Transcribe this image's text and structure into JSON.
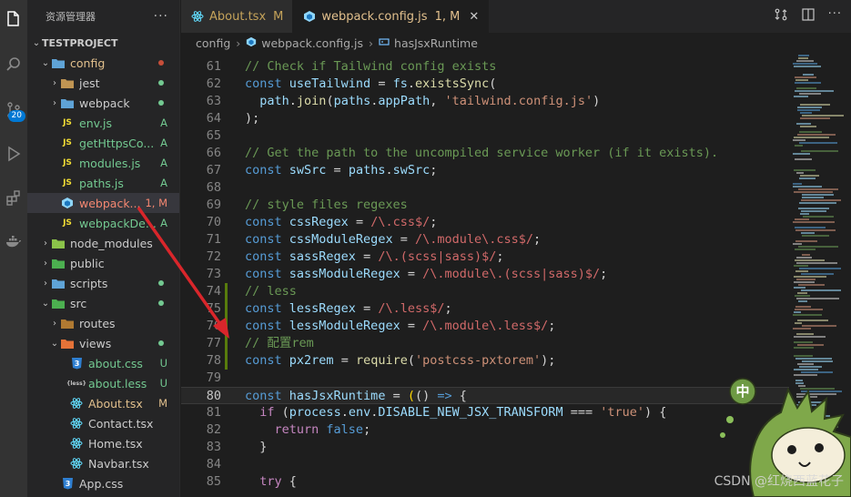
{
  "sidebar": {
    "title": "资源管理器",
    "more_label": "···",
    "tree": [
      {
        "label": "TESTPROJECT",
        "kind": "root",
        "chevron": "open",
        "indent": 0,
        "icon": "",
        "status": "",
        "status_color": ""
      },
      {
        "label": "config",
        "kind": "folder",
        "chevron": "open",
        "indent": 1,
        "icon": "folder-config-icon",
        "status": "dot",
        "status_color": "#c74e39"
      },
      {
        "label": "jest",
        "kind": "folder",
        "chevron": "closed",
        "indent": 2,
        "icon": "folder-icon",
        "status": "dot",
        "status_color": "#73c991"
      },
      {
        "label": "webpack",
        "kind": "folder",
        "chevron": "closed",
        "indent": 2,
        "icon": "folder-webpack-icon",
        "status": "dot",
        "status_color": "#73c991"
      },
      {
        "label": "env.js",
        "kind": "file",
        "chevron": "",
        "indent": 2,
        "icon": "js-icon",
        "status": "A",
        "status_color": "#73c991"
      },
      {
        "label": "getHttpsCo...",
        "kind": "file",
        "chevron": "",
        "indent": 2,
        "icon": "js-icon",
        "status": "A",
        "status_color": "#73c991"
      },
      {
        "label": "modules.js",
        "kind": "file",
        "chevron": "",
        "indent": 2,
        "icon": "js-icon",
        "status": "A",
        "status_color": "#73c991"
      },
      {
        "label": "paths.js",
        "kind": "file",
        "chevron": "",
        "indent": 2,
        "icon": "js-icon",
        "status": "A",
        "status_color": "#73c991"
      },
      {
        "label": "webpack...",
        "kind": "file",
        "chevron": "",
        "indent": 2,
        "icon": "webpack-icon",
        "status": "1, M",
        "status_color": "#f48771",
        "selected": true
      },
      {
        "label": "webpackDe...",
        "kind": "file",
        "chevron": "",
        "indent": 2,
        "icon": "js-icon",
        "status": "A",
        "status_color": "#73c991"
      },
      {
        "label": "node_modules",
        "kind": "folder",
        "chevron": "closed",
        "indent": 1,
        "icon": "folder-node-icon",
        "status": "",
        "status_color": ""
      },
      {
        "label": "public",
        "kind": "folder",
        "chevron": "closed",
        "indent": 1,
        "icon": "folder-public-icon",
        "status": "",
        "status_color": ""
      },
      {
        "label": "scripts",
        "kind": "folder",
        "chevron": "closed",
        "indent": 1,
        "icon": "folder-scripts-icon",
        "status": "dot",
        "status_color": "#73c991"
      },
      {
        "label": "src",
        "kind": "folder",
        "chevron": "open",
        "indent": 1,
        "icon": "folder-src-icon",
        "status": "dot",
        "status_color": "#73c991"
      },
      {
        "label": "routes",
        "kind": "folder",
        "chevron": "closed",
        "indent": 2,
        "icon": "folder-routes-icon",
        "status": "",
        "status_color": ""
      },
      {
        "label": "views",
        "kind": "folder",
        "chevron": "open",
        "indent": 2,
        "icon": "folder-views-icon",
        "status": "dot",
        "status_color": "#73c991"
      },
      {
        "label": "about.css",
        "kind": "file",
        "chevron": "",
        "indent": 3,
        "icon": "css-icon",
        "status": "U",
        "status_color": "#73c991"
      },
      {
        "label": "about.less",
        "kind": "file",
        "chevron": "",
        "indent": 3,
        "icon": "less-icon",
        "status": "U",
        "status_color": "#73c991"
      },
      {
        "label": "About.tsx",
        "kind": "file",
        "chevron": "",
        "indent": 3,
        "icon": "react-icon",
        "status": "M",
        "status_color": "#e2c08d"
      },
      {
        "label": "Contact.tsx",
        "kind": "file",
        "chevron": "",
        "indent": 3,
        "icon": "react-icon",
        "status": "",
        "status_color": ""
      },
      {
        "label": "Home.tsx",
        "kind": "file",
        "chevron": "",
        "indent": 3,
        "icon": "react-icon",
        "status": "",
        "status_color": ""
      },
      {
        "label": "Navbar.tsx",
        "kind": "file",
        "chevron": "",
        "indent": 3,
        "icon": "react-icon",
        "status": "",
        "status_color": ""
      },
      {
        "label": "App.css",
        "kind": "file",
        "chevron": "",
        "indent": 2,
        "icon": "css-icon",
        "status": "",
        "status_color": ""
      }
    ]
  },
  "activity": {
    "items": [
      {
        "icon": "explorer-icon"
      },
      {
        "icon": "search-icon"
      },
      {
        "icon": "source-control-icon",
        "badge": "20"
      },
      {
        "icon": "run-debug-icon"
      },
      {
        "icon": "extensions-icon"
      },
      {
        "icon": "docker-icon"
      }
    ]
  },
  "tabs": [
    {
      "label": "About.tsx",
      "mark": "M",
      "active": false,
      "icon": "react-icon"
    },
    {
      "label": "webpack.config.js",
      "mark": "1, M",
      "active": true,
      "icon": "webpack-icon"
    }
  ],
  "breadcrumb": {
    "parts": [
      "config",
      "webpack.config.js",
      "hasJsxRuntime"
    ]
  },
  "editor": {
    "current_line": "80",
    "lines": [
      {
        "n": "61",
        "tokens": [
          [
            "c",
            "// Check if Tailwind config exists"
          ]
        ]
      },
      {
        "n": "62",
        "tokens": [
          [
            "k",
            "const "
          ],
          [
            "v",
            "useTailwind"
          ],
          [
            "p",
            " = "
          ],
          [
            "v",
            "fs"
          ],
          [
            "p",
            "."
          ],
          [
            "f",
            "existsSync"
          ],
          [
            "p",
            "("
          ]
        ]
      },
      {
        "n": "63",
        "tokens": [
          [
            "p",
            "  "
          ],
          [
            "v",
            "path"
          ],
          [
            "p",
            "."
          ],
          [
            "f",
            "join"
          ],
          [
            "p",
            "("
          ],
          [
            "v",
            "paths"
          ],
          [
            "p",
            "."
          ],
          [
            "v",
            "appPath"
          ],
          [
            "p",
            ", "
          ],
          [
            "s",
            "'tailwind.config.js'"
          ],
          [
            "p",
            ")"
          ]
        ]
      },
      {
        "n": "64",
        "tokens": [
          [
            "p",
            ");"
          ]
        ]
      },
      {
        "n": "65",
        "tokens": []
      },
      {
        "n": "66",
        "tokens": [
          [
            "c",
            "// Get the path to the uncompiled service worker (if it exists)."
          ]
        ]
      },
      {
        "n": "67",
        "tokens": [
          [
            "k",
            "const "
          ],
          [
            "v",
            "swSrc"
          ],
          [
            "p",
            " = "
          ],
          [
            "v",
            "paths"
          ],
          [
            "p",
            "."
          ],
          [
            "v",
            "swSrc"
          ],
          [
            "p",
            ";"
          ]
        ]
      },
      {
        "n": "68",
        "tokens": []
      },
      {
        "n": "69",
        "tokens": [
          [
            "c",
            "// style files regexes"
          ]
        ]
      },
      {
        "n": "70",
        "tokens": [
          [
            "k",
            "const "
          ],
          [
            "v",
            "cssRegex"
          ],
          [
            "p",
            " = "
          ],
          [
            "r",
            "/\\.css$/"
          ],
          [
            "p",
            ";"
          ]
        ]
      },
      {
        "n": "71",
        "tokens": [
          [
            "k",
            "const "
          ],
          [
            "v",
            "cssModuleRegex"
          ],
          [
            "p",
            " = "
          ],
          [
            "r",
            "/\\.module\\.css$/"
          ],
          [
            "p",
            ";"
          ]
        ]
      },
      {
        "n": "72",
        "tokens": [
          [
            "k",
            "const "
          ],
          [
            "v",
            "sassRegex"
          ],
          [
            "p",
            " = "
          ],
          [
            "r",
            "/\\.(scss|sass)$/"
          ],
          [
            "p",
            ";"
          ]
        ]
      },
      {
        "n": "73",
        "tokens": [
          [
            "k",
            "const "
          ],
          [
            "v",
            "sassModuleRegex"
          ],
          [
            "p",
            " = "
          ],
          [
            "r",
            "/\\.module\\.(scss|sass)$/"
          ],
          [
            "p",
            ";"
          ]
        ]
      },
      {
        "n": "74",
        "tokens": [
          [
            "c",
            "// less"
          ]
        ],
        "added": true
      },
      {
        "n": "75",
        "tokens": [
          [
            "k",
            "const "
          ],
          [
            "v",
            "lessRegex"
          ],
          [
            "p",
            " = "
          ],
          [
            "r",
            "/\\.less$/"
          ],
          [
            "p",
            ";"
          ]
        ],
        "added": true
      },
      {
        "n": "76",
        "tokens": [
          [
            "k",
            "const "
          ],
          [
            "v",
            "lessModuleRegex"
          ],
          [
            "p",
            " = "
          ],
          [
            "r",
            "/\\.module\\.less$/"
          ],
          [
            "p",
            ";"
          ]
        ],
        "added": true
      },
      {
        "n": "77",
        "tokens": [
          [
            "c",
            "// 配置rem"
          ]
        ],
        "added": true
      },
      {
        "n": "78",
        "tokens": [
          [
            "k",
            "const "
          ],
          [
            "v",
            "px2rem"
          ],
          [
            "p",
            " = "
          ],
          [
            "f",
            "require"
          ],
          [
            "p",
            "("
          ],
          [
            "s",
            "'postcss-pxtorem'"
          ],
          [
            "p",
            ");"
          ]
        ],
        "added": true
      },
      {
        "n": "79",
        "tokens": []
      },
      {
        "n": "80",
        "tokens": [
          [
            "k",
            "const "
          ],
          [
            "v",
            "hasJsxRuntime"
          ],
          [
            "p",
            " = "
          ],
          [
            "bracket",
            "("
          ],
          [
            "p",
            "() "
          ],
          [
            "k",
            "=>"
          ],
          [
            "p",
            " {"
          ]
        ]
      },
      {
        "n": "81",
        "tokens": [
          [
            "p",
            "  "
          ],
          [
            "kw2",
            "if"
          ],
          [
            "p",
            " ("
          ],
          [
            "v",
            "process"
          ],
          [
            "p",
            "."
          ],
          [
            "v",
            "env"
          ],
          [
            "p",
            "."
          ],
          [
            "v",
            "DISABLE_NEW_JSX_TRANSFORM"
          ],
          [
            "p",
            " === "
          ],
          [
            "s",
            "'true'"
          ],
          [
            "p",
            ") {"
          ]
        ]
      },
      {
        "n": "82",
        "tokens": [
          [
            "p",
            "    "
          ],
          [
            "kw2",
            "return "
          ],
          [
            "k",
            "false"
          ],
          [
            "p",
            ";"
          ]
        ]
      },
      {
        "n": "83",
        "tokens": [
          [
            "p",
            "  }"
          ]
        ]
      },
      {
        "n": "84",
        "tokens": []
      },
      {
        "n": "85",
        "tokens": [
          [
            "p",
            "  "
          ],
          [
            "kw2",
            "try"
          ],
          [
            "p",
            " {"
          ]
        ]
      }
    ]
  },
  "overlay": {
    "badge_char": "中",
    "watermark": "CSDN @红烧西蓝花子"
  },
  "colors": {
    "accent": "#0078d4",
    "modified": "#e2c08d",
    "added": "#73c991",
    "error": "#f48771",
    "arrow": "#d9262b"
  }
}
